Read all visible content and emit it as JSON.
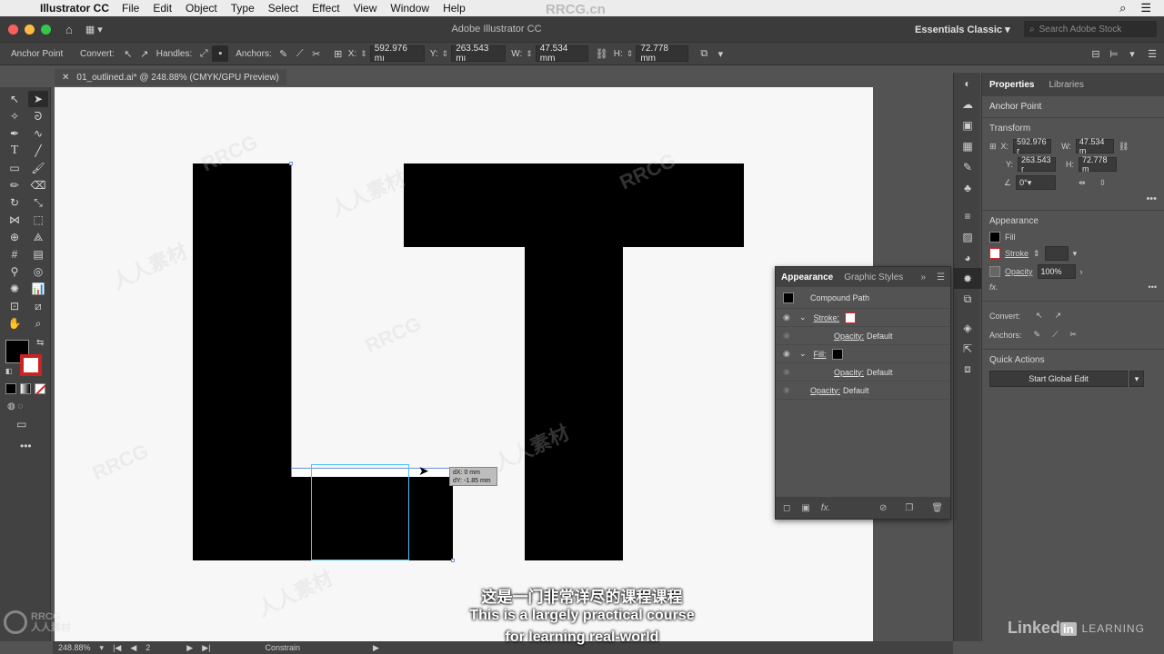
{
  "menubar": {
    "app": "Illustrator CC",
    "items": [
      "File",
      "Edit",
      "Object",
      "Type",
      "Select",
      "Effect",
      "View",
      "Window",
      "Help"
    ]
  },
  "appbar": {
    "window_title": "Adobe Illustrator CC",
    "workspace": "Essentials Classic",
    "search_placeholder": "Search Adobe Stock"
  },
  "control": {
    "tool_label": "Anchor Point",
    "convert_label": "Convert:",
    "handles_label": "Handles:",
    "anchors_label": "Anchors:",
    "x_label": "X:",
    "x_value": "592.976 mı",
    "y_label": "Y:",
    "y_value": "263.543 mı",
    "w_label": "W:",
    "w_value": "47.534 mm",
    "h_label": "H:",
    "h_value": "72.778 mm"
  },
  "document": {
    "tab": "01_outlined.ai* @ 248.88% (CMYK/GPU Preview)"
  },
  "tooltip": {
    "dx": "dX: 0 mm",
    "dy": "dY: -1.85 mm"
  },
  "properties": {
    "tabs": [
      "Properties",
      "Libraries"
    ],
    "selection": "Anchor Point",
    "transform_label": "Transform",
    "x_label": "X:",
    "x_value": "592.976 r",
    "y_label": "Y:",
    "y_value": "263.543 r",
    "w_label": "W:",
    "w_value": "47.534 m",
    "h_label": "H:",
    "h_value": "72.778 m",
    "angle_value": "0°",
    "appearance_label": "Appearance",
    "fill_label": "Fill",
    "stroke_label": "Stroke",
    "opacity_label": "Opacity",
    "opacity_value": "100%",
    "convert_label": "Convert:",
    "anchors_label": "Anchors:",
    "quick_actions_label": "Quick Actions",
    "global_edit_button": "Start Global Edit"
  },
  "appearance_panel": {
    "tabs": [
      "Appearance",
      "Graphic Styles"
    ],
    "object": "Compound Path",
    "stroke_label": "Stroke:",
    "fill_label": "Fill:",
    "opacity_label": "Opacity:",
    "opacity_value": "Default"
  },
  "status": {
    "zoom": "248.88%",
    "page": "2",
    "mode": "Constrain"
  },
  "subtitles": {
    "line1": "这是一门非常详尽的课程课程",
    "line2": "This is a largely practical course",
    "line3": "for learning real-world"
  },
  "watermark": {
    "brand": "RRCG",
    "brand_cn": "人人素材",
    "site": "RRCG.cn"
  },
  "branding": {
    "logo": "Linked",
    "logo_in": "in",
    "learning": "LEARNING"
  }
}
